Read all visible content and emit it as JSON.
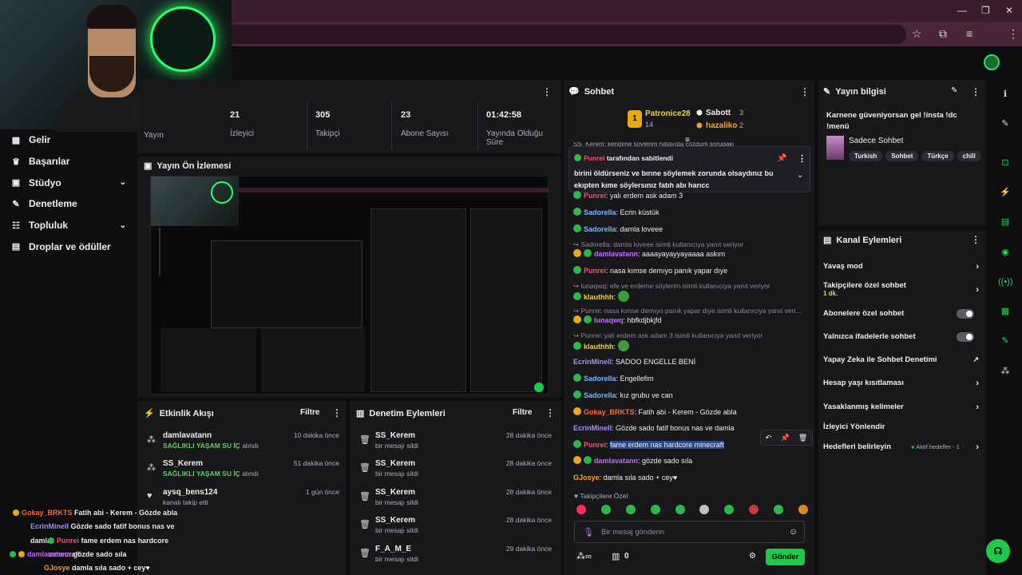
{
  "nav": [
    {
      "label": "Gelir",
      "icon": "money-icon",
      "chevron": false
    },
    {
      "label": "Başarılar",
      "icon": "trophy-icon",
      "chevron": false
    },
    {
      "label": "Stüdyo",
      "icon": "studio-icon",
      "chevron": true
    },
    {
      "label": "Denetleme",
      "icon": "wrench-icon",
      "chevron": false
    },
    {
      "label": "Topluluk",
      "icon": "community-icon",
      "chevron": true
    },
    {
      "label": "Droplar ve ödüller",
      "icon": "drops-icon",
      "chevron": false
    }
  ],
  "stats": {
    "yayin_label": "Yayın",
    "items": [
      {
        "value": "21",
        "label": "İzleyici"
      },
      {
        "value": "305",
        "label": "Takipçi"
      },
      {
        "value": "23",
        "label": "Abone Sayısı"
      },
      {
        "value": "01:42:58",
        "label": "Yayında Olduğu Süre"
      }
    ]
  },
  "preview": {
    "title": "Yayın Ön İzlemesi"
  },
  "activity": {
    "title": "Etkinlik Akışı",
    "filter": "Filtre",
    "events": [
      {
        "name": "damlavatann",
        "sub": "SAĞLIKLI YAŞAM SU İÇ",
        "sub2": "alındı",
        "time": "10 dakika önce",
        "icon": "points-icon"
      },
      {
        "name": "SS_Kerem",
        "sub": "SAĞLIKLI YAŞAM SU İÇ",
        "sub2": "alındı",
        "time": "51 dakika önce",
        "icon": "points-icon"
      },
      {
        "name": "aysq_bens124",
        "sub": "kanalı takip etti",
        "sub2": "",
        "time": "1 gün önce",
        "icon": "heart-icon"
      }
    ]
  },
  "moderation": {
    "title": "Denetim Eylemleri",
    "filter": "Filtre",
    "events": [
      {
        "name": "SS_Kerem",
        "sub": "bir mesajı sildi",
        "time": "28 dakika önce"
      },
      {
        "name": "SS_Kerem",
        "sub": "bir mesajı sildi",
        "time": "28 dakika önce"
      },
      {
        "name": "SS_Kerem",
        "sub": "bir mesajı sildi",
        "time": "28 dakika önce"
      },
      {
        "name": "SS_Kerem",
        "sub": "bir mesajı sildi",
        "time": "28 dakika önce"
      },
      {
        "name": "F_A_M_E",
        "sub": "bir mesajı sildi",
        "time": "29 dakika önce"
      }
    ]
  },
  "overlay": [
    {
      "user": "Gokay_BRKTS",
      "text": "Fatih abi - Kerem - Gözde abla",
      "color": "#ff6a3d"
    },
    {
      "user": "EcrinMinell",
      "text": "Gözde sado fatif bonus nas ve damla",
      "color": "#a98cff"
    },
    {
      "user": "Punrei",
      "text": "fame erdem nas hardcore mınecraft",
      "color": "#ff4d6d"
    },
    {
      "user": "damlavatann",
      "text": "gözde sado sıla",
      "color": "#c66cff"
    },
    {
      "user": "GJosye",
      "text": "damla sıla sado + cey♥",
      "color": "#ff9f2f"
    }
  ],
  "chat": {
    "title": "Sohbet",
    "top": [
      {
        "rank": "1",
        "name": "Patronice28",
        "count": "14"
      },
      {
        "name": "Sabott",
        "count": "3"
      },
      {
        "name": "hazaliko",
        "count": "2"
      }
    ],
    "cut_line": "SS_Kerem: kendime söylerim hatayıda çözdüm sorugaki",
    "pinned": {
      "by": "Punrei",
      "by_suffix": "tarafından sabitlendi",
      "text": "birini öldürseniz ve bırıne söylemek zorunda olsaydınız bu ekıpten kıme söylersınız fatıh abı harıcc"
    },
    "messages": [
      {
        "user": "Punrei",
        "text": "yalı erdem ask adam 3",
        "color": "#ff4d6d",
        "reply": ""
      },
      {
        "user": "Sadorella",
        "text": "Ecrin küstük",
        "color": "#72b8ff",
        "reply": ""
      },
      {
        "user": "Sadorella",
        "text": "damla loveee",
        "color": "#72b8ff",
        "reply": ""
      },
      {
        "user": "damlavatann",
        "text": "aaaayayayyayaaaa askım",
        "color": "#c66cff",
        "reply": "Sadorella: damla loveee isimli kullanıcıya yanıt veriyor"
      },
      {
        "user": "Punrei",
        "text": "nasa kımse demıyo panık yapar dıye",
        "color": "#ff4d6d",
        "reply": ""
      },
      {
        "user": "klauthhh",
        "text": "",
        "color": "#e8d34a",
        "reply": "lunaqwq: efe ve erdeme söylerim isimli kullanıcıya yanıt veriyor"
      },
      {
        "user": "lunaqwq",
        "text": "hbfkdjbkjfd",
        "color": "#c66cff",
        "reply": "Punrei: nasa kımse demıyo panık yapar dıye isimli kullanıcıya yanıt veri..."
      },
      {
        "user": "klauthhh",
        "text": "",
        "color": "#e8d34a",
        "reply": "Punrei: yalı erdem ask adam 3 isimli kullanıcıya yanıt veriyor"
      },
      {
        "user": "EcrinMinell",
        "text": "SADOO ENGELLE BENİ",
        "color": "#a98cff",
        "reply": ""
      },
      {
        "user": "Sadorella",
        "text": "Engellefim",
        "color": "#72b8ff",
        "reply": ""
      },
      {
        "user": "Sadorella",
        "text": "kız grubu ve can",
        "color": "#72b8ff",
        "reply": ""
      },
      {
        "user": "Gokay_BRKTS",
        "text": "Fatih abi - Kerem - Gözde abla",
        "color": "#ff6a3d",
        "reply": ""
      },
      {
        "user": "EcrinMinell",
        "text": "Gözde sado fatif bonus nas ve damla",
        "color": "#a98cff",
        "reply": ""
      },
      {
        "user": "Punrei",
        "text": "fame erdem nas hardcore minecraft",
        "color": "#ff4d6d",
        "reply": ""
      },
      {
        "user": "damlavatann",
        "text": "gözde sado sıla",
        "color": "#c66cff",
        "reply": ""
      },
      {
        "user": "GJosye",
        "text": "damla sıla sado + cey♥",
        "color": "#ff9f2f",
        "reply": ""
      }
    ],
    "followers_only": "Takipçilere Özel",
    "input_placeholder": "Bir mesaj gönderin",
    "points": "0",
    "send": "Gönder"
  },
  "info": {
    "title": "Yayın bilgisi",
    "stream_title": "Karnene güveniyorsan gel !insta !dc !menü",
    "category": "Sadece Sohbet",
    "tags": [
      "Turkish",
      "Sohbet",
      "Türkçe",
      "chill"
    ]
  },
  "actions": {
    "title": "Kanal Eylemleri",
    "items": [
      {
        "label": "Yavaş mod",
        "sub": "",
        "type": "arrow",
        "extra": ""
      },
      {
        "label": "Takipçilere özel sohbet",
        "sub": "1 dk.",
        "type": "arrow",
        "extra": ""
      },
      {
        "label": "Abonelere özel sohbet",
        "sub": "",
        "type": "toggle",
        "extra": ""
      },
      {
        "label": "Yalnızca ifadelerle sohbet",
        "sub": "",
        "type": "toggle",
        "extra": ""
      },
      {
        "label": "Yapay Zeka ile Sohbet Denetimi",
        "sub": "",
        "type": "external",
        "extra": ""
      },
      {
        "label": "Hesap yaşı kısıtlaması",
        "sub": "",
        "type": "arrow",
        "extra": ""
      },
      {
        "label": "Yasaklanmış kelimeler",
        "sub": "",
        "type": "arrow",
        "extra": ""
      },
      {
        "label": "İzleyici Yönlendir",
        "sub": "",
        "type": "none",
        "extra": ""
      },
      {
        "label": "Hedefleri belirleyin",
        "sub": "",
        "type": "arrow",
        "extra": "Aktif hedefler - 1"
      }
    ]
  },
  "colors": {
    "accent": "#1fc94b",
    "bg": "#0e0e10",
    "panel": "#18181b"
  }
}
